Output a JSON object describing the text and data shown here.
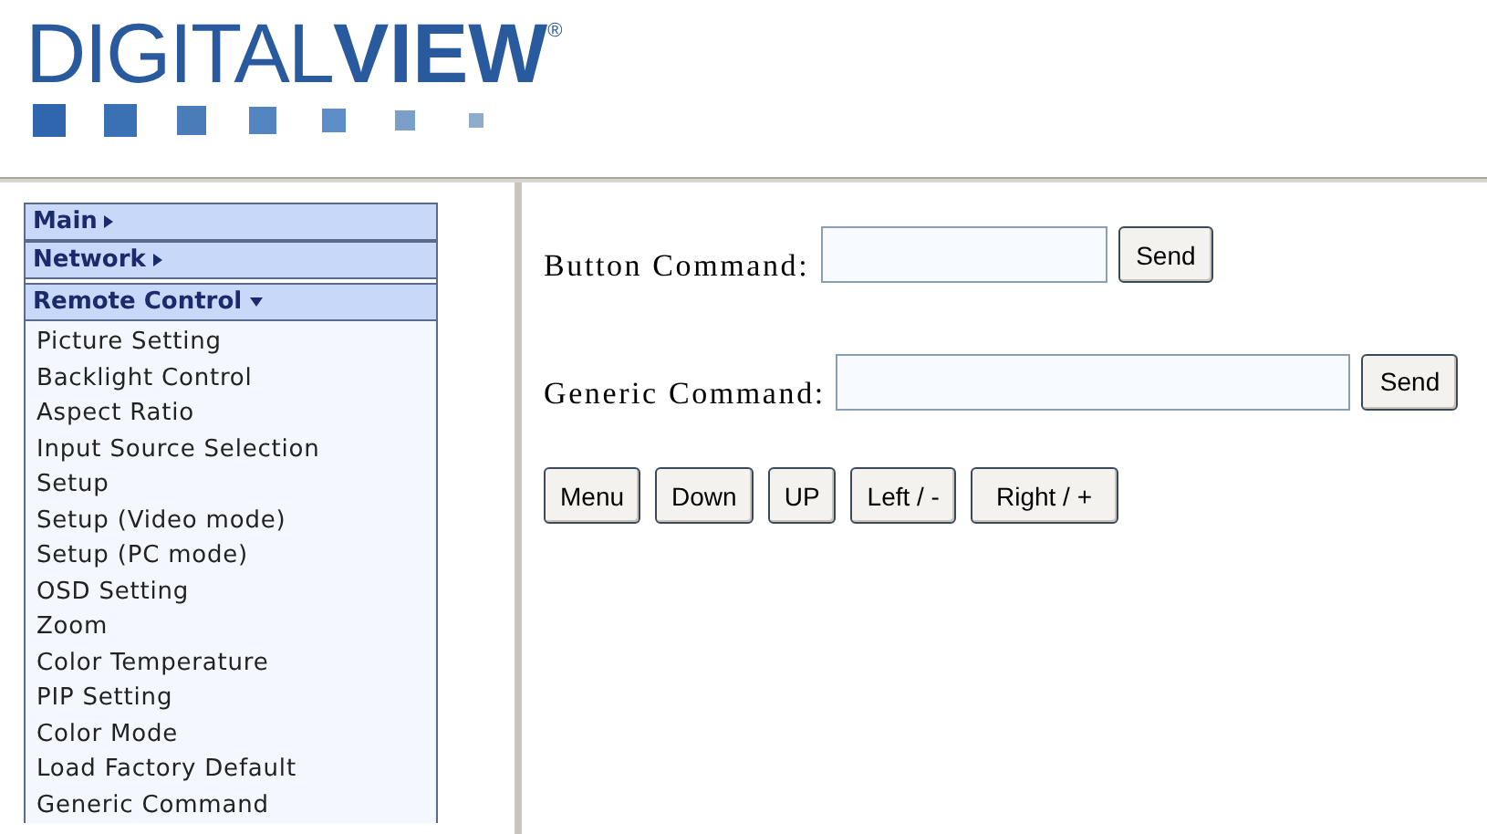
{
  "logo": {
    "light": "DIGITAL",
    "bold": "VIEW",
    "mark": "®"
  },
  "sidebar": {
    "sections": [
      {
        "label": "Main",
        "expanded": false
      },
      {
        "label": "Network",
        "expanded": false
      },
      {
        "label": "Remote Control",
        "expanded": true,
        "items": [
          "Picture Setting",
          "Backlight Control",
          "Aspect Ratio",
          "Input Source Selection",
          "Setup",
          "Setup (Video mode)",
          "Setup (PC mode)",
          "OSD Setting",
          "Zoom",
          "Color Temperature",
          "PIP Setting",
          "Color Mode",
          "Load Factory Default",
          "Generic Command"
        ]
      }
    ]
  },
  "form": {
    "rows": [
      {
        "label": "Button Command:",
        "button": "Send",
        "wide": false
      },
      {
        "label": "Generic Command:",
        "button": "Send",
        "wide": true
      }
    ],
    "keys": [
      "Menu",
      "Down",
      "UP",
      "Left / -",
      "Right / +"
    ]
  }
}
